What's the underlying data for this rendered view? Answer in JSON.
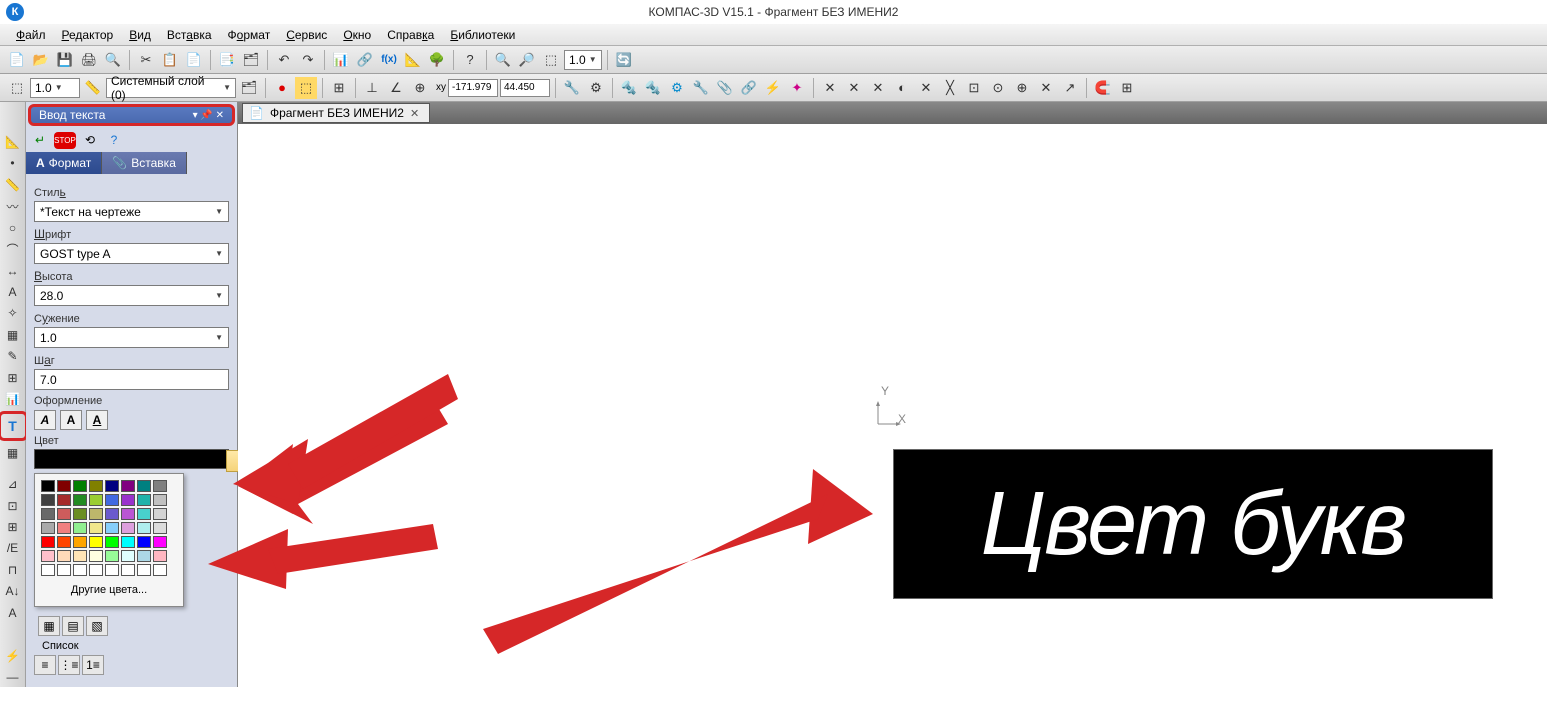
{
  "title": "КОМПАС-3D V15.1 - Фрагмент БЕЗ ИМЕНИ2",
  "app_icon": "К",
  "menu": {
    "file": "Файл",
    "editor": "Редактор",
    "view": "Вид",
    "insert": "Вставка",
    "format": "Формат",
    "service": "Сервис",
    "window": "Окно",
    "help": "Справка",
    "libs": "Библиотеки"
  },
  "toolbar2": {
    "scale": "1.0",
    "layer": "Системный слой (0)",
    "coord_x": "-171.979",
    "coord_y": "44.450",
    "zoom": "1.0"
  },
  "panel": {
    "title": "Ввод текста",
    "tabs": {
      "format": "Формат",
      "insert": "Вставка"
    },
    "style_label": "Стиль",
    "style_value": "*Текст на чертеже",
    "font_label": "Шрифт",
    "font_value": "GOST type A",
    "height_label": "Высота",
    "height_value": "28.0",
    "narrow_label": "Сужение",
    "narrow_value": "1.0",
    "step_label": "Шаг",
    "step_value": "7.0",
    "decoration_label": "Оформление",
    "color_label": "Цвет",
    "other_colors": "Другие цвета...",
    "list_label": "Список"
  },
  "doc_tab": "Фрагмент БЕЗ ИМЕНИ2",
  "canvas_text": "Цвет букв",
  "axis": {
    "x": "X",
    "y": "Y"
  },
  "color_palette": [
    [
      "#000000",
      "#800000",
      "#008000",
      "#808000",
      "#000080",
      "#800080",
      "#008080",
      "#808080"
    ],
    [
      "#404040",
      "#a52a2a",
      "#228b22",
      "#9acd32",
      "#4169e1",
      "#9932cc",
      "#20b2aa",
      "#c0c0c0"
    ],
    [
      "#696969",
      "#cd5c5c",
      "#6b8e23",
      "#bdb76b",
      "#6a5acd",
      "#ba55d3",
      "#48d1cc",
      "#d3d3d3"
    ],
    [
      "#a9a9a9",
      "#f08080",
      "#90ee90",
      "#f0e68c",
      "#87cefa",
      "#dda0dd",
      "#afeeee",
      "#dcdcdc"
    ],
    [
      "#ff0000",
      "#ff4500",
      "#ffa500",
      "#ffff00",
      "#00ff00",
      "#00ffff",
      "#0000ff",
      "#ff00ff"
    ],
    [
      "#ffc0cb",
      "#ffdab9",
      "#ffe4b5",
      "#ffffe0",
      "#98fb98",
      "#e0ffff",
      "#add8e6",
      "#ffb6c1"
    ],
    [
      "#ffffff",
      "#ffffff",
      "#ffffff",
      "#ffffff",
      "#ffffff",
      "#ffffff",
      "#ffffff",
      "#ffffff"
    ]
  ]
}
